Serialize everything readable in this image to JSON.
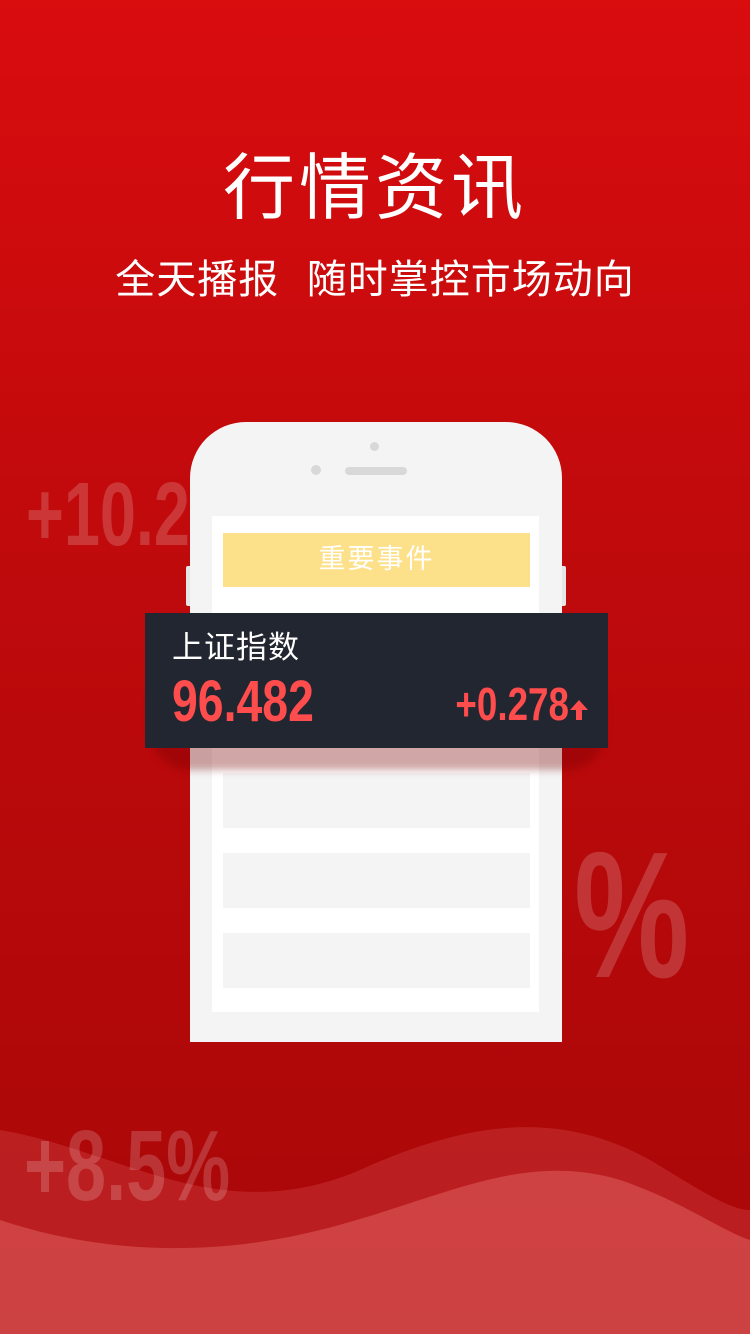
{
  "header": {
    "title": "行情资讯",
    "subtitle": "全天播报  随时掌控市场动向"
  },
  "background_numbers": {
    "top_left": "+10.2",
    "right": "%",
    "bottom_left": "+8.5%"
  },
  "phone": {
    "event_label": "重要事件"
  },
  "index_card": {
    "name": "上证指数",
    "value": "96.482",
    "change": "+0.278",
    "trend_icon": "arrow-up-icon"
  },
  "colors": {
    "background_top": "#d90c0e",
    "background_bottom": "#a80708",
    "accent_red": "#ff4c4c",
    "card_dark": "#222631",
    "event_yellow": "#fde08a"
  }
}
